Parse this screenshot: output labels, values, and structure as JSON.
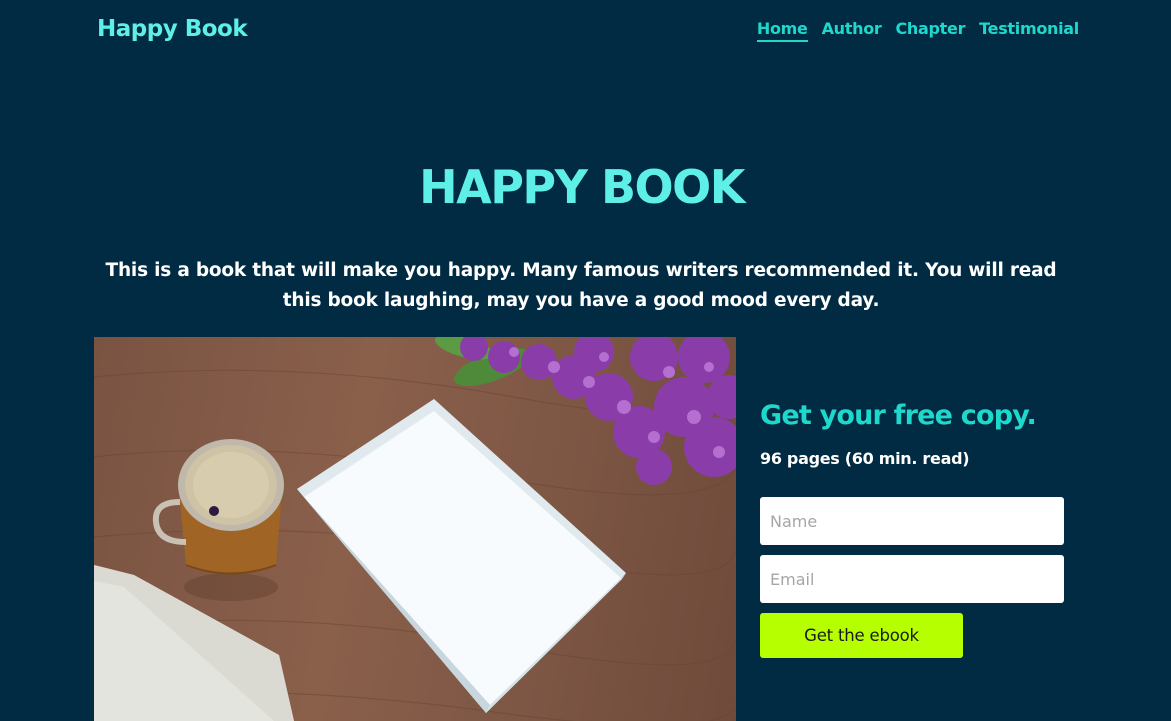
{
  "header": {
    "brand": "Happy Book",
    "nav": [
      {
        "label": "Home",
        "active": true
      },
      {
        "label": "Author",
        "active": false
      },
      {
        "label": "Chapter",
        "active": false
      },
      {
        "label": "Testimonial",
        "active": false
      }
    ]
  },
  "hero": {
    "title": "HAPPY BOOK",
    "description": "This is a book that will make you happy. Many famous writers recommended it. You will read this book laughing, may you have a good mood every day."
  },
  "signup": {
    "title": "Get your free copy.",
    "subtitle": "96 pages (60 min. read)",
    "name_placeholder": "Name",
    "email_placeholder": "Email",
    "button_label": "Get the ebook"
  },
  "colors": {
    "background": "#002b42",
    "brand": "#5ef0e8",
    "accent": "#1fd8cc",
    "button": "#b5ff00"
  }
}
